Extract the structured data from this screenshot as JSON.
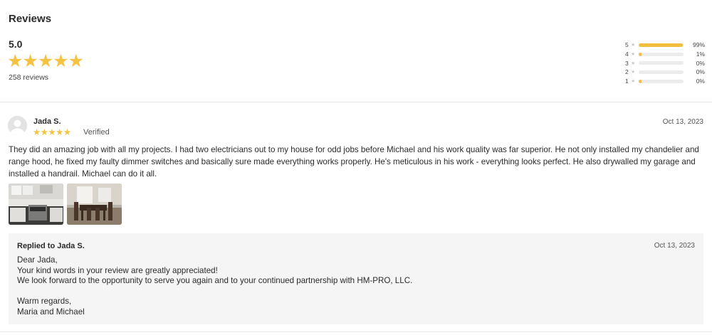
{
  "reviews": {
    "title": "Reviews",
    "rating": "5.0",
    "stars_glyph": "★★★★★",
    "review_count": "258 reviews",
    "histogram": [
      {
        "stars": "5",
        "percent": "99%",
        "fraction": 0.99
      },
      {
        "stars": "4",
        "percent": "1%",
        "fraction": 0.06
      },
      {
        "stars": "3",
        "percent": "0%",
        "fraction": 0
      },
      {
        "stars": "2",
        "percent": "0%",
        "fraction": 0
      },
      {
        "stars": "1",
        "percent": "0%",
        "fraction": 0.06
      }
    ],
    "star_glyph": "★"
  },
  "review": {
    "author": "Jada S.",
    "stars_glyph": "★★★★★",
    "verified": "Verified",
    "date": "Oct 13, 2023",
    "text": "They did an amazing job with all my projects. I had two electricians out to my house for odd jobs before Michael and his work quality was far superior. He not only installed my chandelier and range hood, he fixed my faulty dimmer switches and basically sure made everything works properly. He's meticulous in his work - everything looks perfect. He also drywalled my garage and installed a handrail. Michael can do it all.",
    "photos": [
      "kitchen-photo",
      "dining-room-photo"
    ]
  },
  "reply": {
    "heading": "Replied to Jada S.",
    "date": "Oct 13, 2023",
    "lines": [
      "Dear Jada,",
      "Your kind words in your review are greatly appreciated!",
      "We look forward to the opportunity to serve you again and to your continued partnership with HM-PRO, LLC.",
      "",
      "Warm regards,",
      "Maria and Michael"
    ]
  },
  "colors": {
    "star": "#f5c242",
    "bar_fill": "#f2be3e",
    "bar_track": "#ececec",
    "reply_bg": "#f5f5f5"
  }
}
